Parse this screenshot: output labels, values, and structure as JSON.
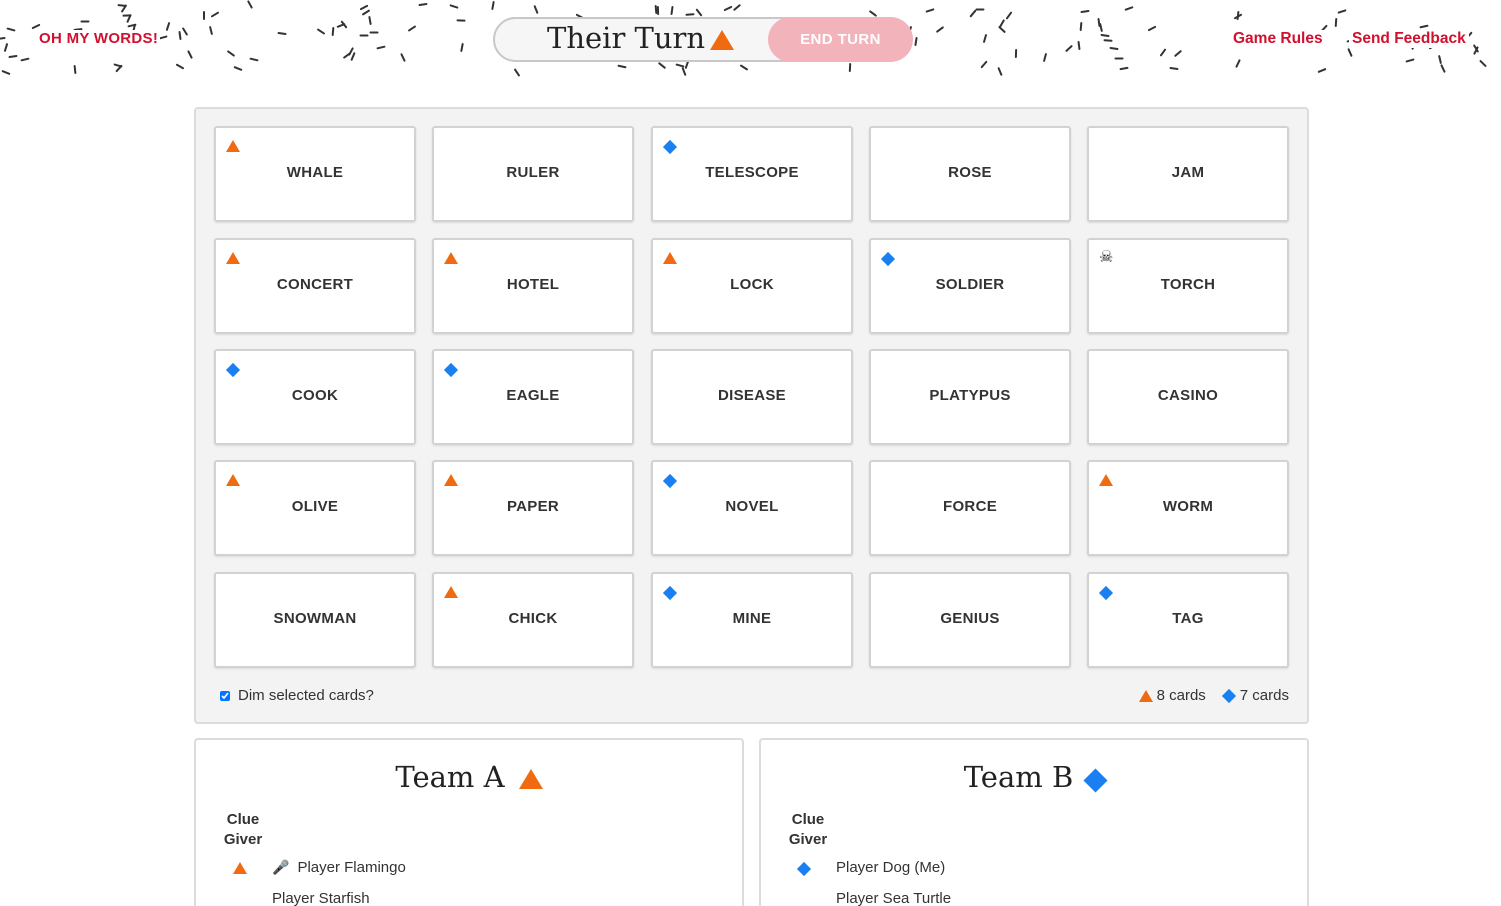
{
  "header": {
    "brand": "OH MY WORDS!",
    "turn_label": "Their Turn",
    "turn_team_icon": "orange-triangle",
    "end_turn_label": "END TURN",
    "links": [
      "Game Rules",
      "Send Feedback"
    ]
  },
  "colors": {
    "accent_red": "#d0102f",
    "team_a_orange": "#ef6a10",
    "team_b_blue": "#1a7ff0",
    "end_turn_bg": "#f2b3ba"
  },
  "board": {
    "cards": [
      {
        "word": "WHALE",
        "marker": "triangle"
      },
      {
        "word": "RULER",
        "marker": ""
      },
      {
        "word": "TELESCOPE",
        "marker": "diamond"
      },
      {
        "word": "ROSE",
        "marker": ""
      },
      {
        "word": "JAM",
        "marker": ""
      },
      {
        "word": "CONCERT",
        "marker": "triangle"
      },
      {
        "word": "HOTEL",
        "marker": "triangle"
      },
      {
        "word": "LOCK",
        "marker": "triangle"
      },
      {
        "word": "SOLDIER",
        "marker": "diamond"
      },
      {
        "word": "TORCH",
        "marker": "skull"
      },
      {
        "word": "COOK",
        "marker": "diamond"
      },
      {
        "word": "EAGLE",
        "marker": "diamond"
      },
      {
        "word": "DISEASE",
        "marker": ""
      },
      {
        "word": "PLATYPUS",
        "marker": ""
      },
      {
        "word": "CASINO",
        "marker": ""
      },
      {
        "word": "OLIVE",
        "marker": "triangle"
      },
      {
        "word": "PAPER",
        "marker": "triangle"
      },
      {
        "word": "NOVEL",
        "marker": "diamond"
      },
      {
        "word": "FORCE",
        "marker": ""
      },
      {
        "word": "WORM",
        "marker": "triangle"
      },
      {
        "word": "SNOWMAN",
        "marker": ""
      },
      {
        "word": "CHICK",
        "marker": "triangle"
      },
      {
        "word": "MINE",
        "marker": "diamond"
      },
      {
        "word": "GENIUS",
        "marker": ""
      },
      {
        "word": "TAG",
        "marker": "diamond"
      }
    ],
    "dim_label": "Dim selected cards?",
    "dim_checked": true,
    "team_a_count": "8 cards",
    "team_b_count": "7 cards"
  },
  "teams": {
    "a": {
      "name": "Team A",
      "clue_giver_label": "Clue\nGiver",
      "clue_giver": "Player Flamingo",
      "players": [
        "Player Starfish"
      ]
    },
    "b": {
      "name": "Team B",
      "clue_giver_label": "Clue\nGiver",
      "clue_giver": "Player Dog (Me)",
      "players": [
        "Player Sea Turtle"
      ]
    }
  }
}
